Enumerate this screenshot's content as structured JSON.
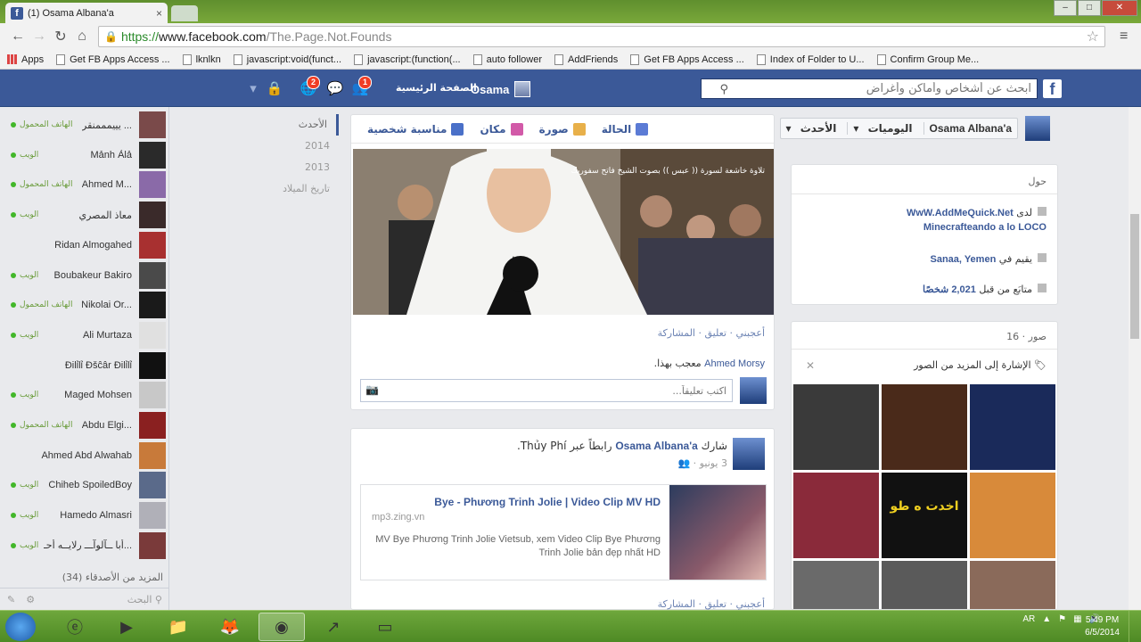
{
  "browser": {
    "tab_title": "(1) Osama Albana'a",
    "tab_favicon": "f",
    "close_glyph": "×",
    "url_scheme": "https://",
    "url_host": "www.facebook.com",
    "url_path": "/The.Page.Not.Founds",
    "bookmarks": [
      "Apps",
      "Get FB Apps Access ...",
      "lknlkn",
      "javascript:void(funct...",
      "javascript:(function(...",
      "auto follower",
      "AddFriends",
      "Get FB Apps Access ...",
      "Index of Folder to U...",
      "Confirm Group Me..."
    ]
  },
  "fb": {
    "logo": "f",
    "search_placeholder": "ابحث عن أشخاص وأماكن وأغراض",
    "user_name": "Osama",
    "home_label": "الصفحة الرئيسية",
    "friend_badge": "1",
    "notif_badge": "2"
  },
  "chat": {
    "friends": [
      {
        "name": "يييمممنقر ...",
        "status": "الهاتف المحمول",
        "color": "#7a4a4a"
      },
      {
        "name": "Mảnh Ảlả",
        "status": "الويب",
        "color": "#2a2a2a"
      },
      {
        "name": "Ahmed M...",
        "status": "الهاتف المحمول",
        "color": "#8a6aa8"
      },
      {
        "name": "معاذ المصري",
        "status": "الويب",
        "color": "#3a2a2a"
      },
      {
        "name": "Ridan Almogahed",
        "status": "",
        "color": "#a83030"
      },
      {
        "name": "Boubakeur Bakiro",
        "status": "الويب",
        "color": "#4a4a4a"
      },
      {
        "name": "Nikolai Or...",
        "status": "الهاتف المحمول",
        "color": "#1a1a1a"
      },
      {
        "name": "Ali Murtaza",
        "status": "الويب",
        "color": "#e0e0e0"
      },
      {
        "name": "Ðilỉlỉ Ðšĉâr Ðilỉlỉ",
        "status": "",
        "color": "#111111"
      },
      {
        "name": "Maged Mohsen",
        "status": "الويب",
        "color": "#c8c8c8"
      },
      {
        "name": "Abdu Elgi...",
        "status": "الهاتف المحمول",
        "color": "#8a2020"
      },
      {
        "name": "Ahmed Abd Alwahab",
        "status": "",
        "color": "#c87a3a"
      },
      {
        "name": "Chiheb SpoiledBoy",
        "status": "الويب",
        "color": "#5a6a8a"
      },
      {
        "name": "Hamedo Almasri",
        "status": "الويب",
        "color": "#b0b0b8"
      },
      {
        "name": "أبا ــآلوآـــ رلايــه أحـ...",
        "status": "الويب",
        "color": "#7a3a3a"
      }
    ],
    "more_label": "(34) المزيد من الأصدقاء",
    "search_label": "البحث"
  },
  "years": [
    "الأحدث",
    "2014",
    "2013",
    "تاريخ الميلاد"
  ],
  "selector": {
    "name": "Osama Albana'a",
    "timeline": "اليوميات",
    "recent": "الأحدث"
  },
  "composer": {
    "tabs": [
      "الحالة",
      "صورة",
      "مكان",
      "مناسبة شخصية"
    ],
    "photo_caption": "تلاوة خاشعة لسورة (( عبس )) بصوت الشيخ فاتح سفوريك",
    "actions": "أعجبني · تعليق · المشاركة",
    "liker": "Ahmed Morsy",
    "likes_suffix": "معجب بهذا.",
    "comment_placeholder": "اكتب تعليقاً..."
  },
  "post": {
    "author": "Osama Albana'a",
    "verb": "شارك",
    "via": "رابطاً عبر",
    "via_name": "Thủy Phí",
    "time": "3 يونيو",
    "link_title": "Bye - Phương Trinh Jolie | Video Clip MV HD",
    "link_source": "mp3.zing.vn",
    "link_desc": "MV Bye Phương Trinh Jolie Vietsub, xem Video Clip Bye Phương Trinh Jolie bản đẹp nhất HD",
    "actions": "أعجبني · تعليق · المشاركة"
  },
  "about": {
    "title": "حول",
    "work_prefix": "لدى",
    "work_lines": [
      "WwW.AddMeQuick.Net",
      "Minecrafteando a lo LOCO"
    ],
    "lives_prefix": "يقيم في",
    "lives": "Sanaa, Yemen",
    "followers_prefix": "متابَع من قبل",
    "followers": "2,021 شخصًا"
  },
  "photos": {
    "title": "صور · 16",
    "tag_label": "الإشارة إلى المزيد من الصور",
    "thumbs": [
      "#3a3a3a",
      "#4a2a1a",
      "#1a2a5a",
      "#8a2a3a",
      "#111111",
      "#d88a3a",
      "#6a6a6a",
      "#5a5a5a",
      "#8a6a5a"
    ],
    "thumb_texts": [
      "",
      "",
      "",
      "",
      "اخدت ه طو",
      "",
      "",
      "",
      ""
    ]
  },
  "taskbar": {
    "lang": "AR",
    "time": "5:49 PM",
    "date": "6/5/2014"
  },
  "colors": {
    "fb_blue": "#3b5998",
    "link_blue": "#3b5998",
    "online_green": "#42b72a",
    "chrome_green": "#79a83a"
  }
}
